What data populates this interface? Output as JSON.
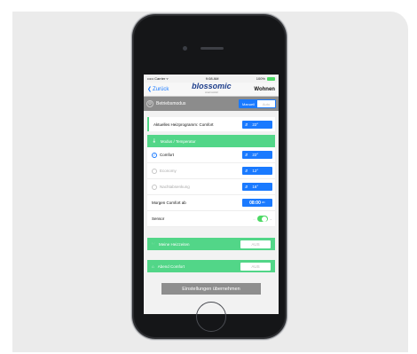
{
  "status": {
    "carrier": "••••• Carrier ▿",
    "time": "9:08 AM",
    "battery": "100%"
  },
  "nav": {
    "back": "Zurück",
    "logo": "blossomic",
    "logo_sub": "smart control",
    "title": "Wohnen"
  },
  "mode": {
    "label": "Betriebsmodus",
    "manual": "Manuell",
    "auto": "Auto"
  },
  "program": {
    "label": "Aktuelles Heizprogramm: Comfort",
    "value": "22°"
  },
  "modus": {
    "title": "Modus / Temperatur",
    "items": [
      {
        "label": "Comfort",
        "value": "22°"
      },
      {
        "label": "Economy",
        "value": "12°"
      },
      {
        "label": "Nachtabsenkung",
        "value": "16°"
      }
    ],
    "morgen_label": "Morgen Comfort ab",
    "morgen_time": "08:00",
    "morgen_unit": "Uhr",
    "sensor_label": "Sensor"
  },
  "heizzeiten": {
    "label": "Meine Heizzeiten",
    "value": "AUS"
  },
  "abend": {
    "label": "Abend Comfort",
    "value": "AUS"
  },
  "apply": {
    "label": "Einstellungen übernehmen"
  },
  "colors": {
    "accent": "#1a7aff",
    "green": "#52d688",
    "gray": "#8c8c8c"
  }
}
